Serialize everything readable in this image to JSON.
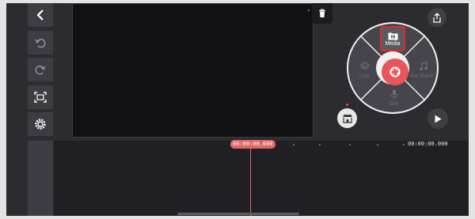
{
  "toolbar": {
    "items": [
      {
        "icon": "back-arrow-icon"
      },
      {
        "icon": "undo-icon"
      },
      {
        "icon": "redo-icon"
      },
      {
        "icon": "fit-screen-icon"
      },
      {
        "icon": "settings-gear-icon"
      },
      {
        "icon": "expand-vertical-icon"
      },
      {
        "icon": "jump-to-end-icon"
      }
    ]
  },
  "wheel": {
    "media_label": "Media",
    "layer_label": "Lớp",
    "audio_label": "Âm thanh",
    "voice_label": "Ghi"
  },
  "timeline": {
    "current_time": "00:00:00.000",
    "end_time": "00:00:00.000"
  },
  "colors": {
    "accent": "#e8555a",
    "highlight_border": "#e02a2a",
    "background": "#2b2b30"
  }
}
